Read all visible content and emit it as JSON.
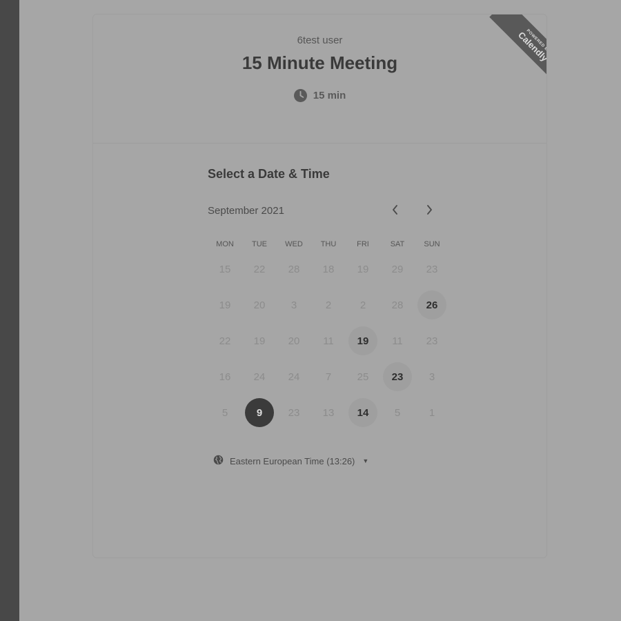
{
  "header": {
    "owner": "6test user",
    "title": "15 Minute Meeting",
    "duration": "15 min"
  },
  "badge": {
    "small_text": "POWERED BY",
    "brand": "Calendly"
  },
  "scheduler": {
    "title": "Select a Date & Time",
    "month": "September 2021",
    "weekdays": [
      "MON",
      "TUE",
      "WED",
      "THU",
      "FRI",
      "SAT",
      "SUN"
    ],
    "rows": [
      [
        {
          "label": "15",
          "state": "unavailable"
        },
        {
          "label": "22",
          "state": "unavailable"
        },
        {
          "label": "28",
          "state": "unavailable"
        },
        {
          "label": "18",
          "state": "unavailable"
        },
        {
          "label": "19",
          "state": "unavailable"
        },
        {
          "label": "29",
          "state": "unavailable"
        },
        {
          "label": "23",
          "state": "unavailable"
        }
      ],
      [
        {
          "label": "19",
          "state": "unavailable"
        },
        {
          "label": "20",
          "state": "unavailable"
        },
        {
          "label": "3",
          "state": "unavailable"
        },
        {
          "label": "2",
          "state": "unavailable"
        },
        {
          "label": "2",
          "state": "unavailable"
        },
        {
          "label": "28",
          "state": "unavailable"
        },
        {
          "label": "26",
          "state": "available"
        }
      ],
      [
        {
          "label": "22",
          "state": "unavailable"
        },
        {
          "label": "19",
          "state": "unavailable"
        },
        {
          "label": "20",
          "state": "unavailable"
        },
        {
          "label": "11",
          "state": "unavailable"
        },
        {
          "label": "19",
          "state": "available"
        },
        {
          "label": "11",
          "state": "unavailable"
        },
        {
          "label": "23",
          "state": "unavailable"
        }
      ],
      [
        {
          "label": "16",
          "state": "unavailable"
        },
        {
          "label": "24",
          "state": "unavailable"
        },
        {
          "label": "24",
          "state": "unavailable"
        },
        {
          "label": "7",
          "state": "unavailable"
        },
        {
          "label": "25",
          "state": "unavailable"
        },
        {
          "label": "23",
          "state": "available"
        },
        {
          "label": "3",
          "state": "unavailable"
        }
      ],
      [
        {
          "label": "5",
          "state": "unavailable"
        },
        {
          "label": "9",
          "state": "selected"
        },
        {
          "label": "23",
          "state": "unavailable"
        },
        {
          "label": "13",
          "state": "unavailable"
        },
        {
          "label": "14",
          "state": "available"
        },
        {
          "label": "5",
          "state": "unavailable"
        },
        {
          "label": "1",
          "state": "unavailable"
        }
      ]
    ],
    "timezone": "Eastern European Time (13:26)"
  },
  "icons": {
    "duration": "clock-icon",
    "prev": "chevron-left-icon",
    "next": "chevron-right-icon",
    "timezone": "globe-icon",
    "dropdown": "caret-down-icon"
  },
  "colors": {
    "background": "#a6a6a6",
    "sidebar": "#484848",
    "selected_day": "#3b3b3b",
    "available_day": "#9f9f9f",
    "ribbon": "#595959"
  }
}
